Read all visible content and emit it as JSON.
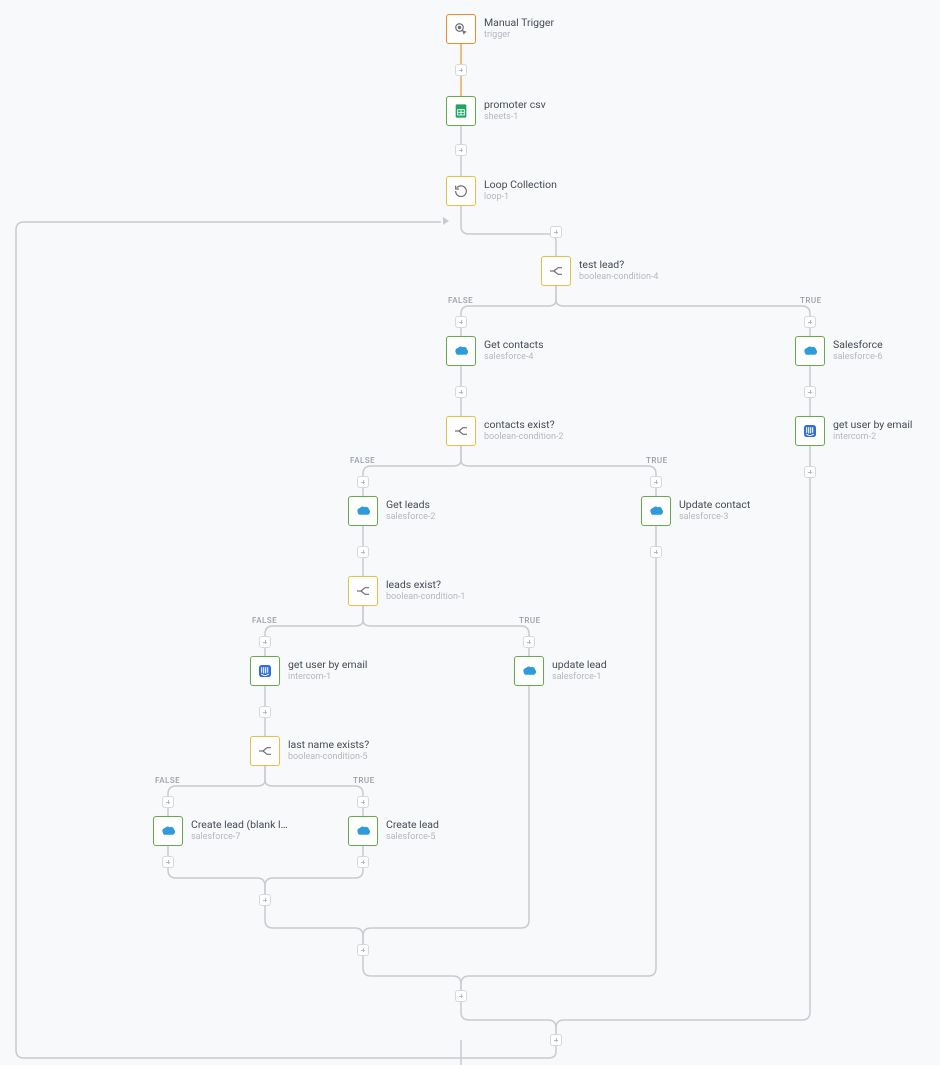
{
  "labels": {
    "true": "TRUE",
    "false": "FALSE"
  },
  "colors": {
    "orange": "#f28c28",
    "green": "#6aa84f",
    "yellow": "#e1c24a",
    "edge": "#c7cbd1",
    "edge_orange": "#f4a35a"
  },
  "nodes": {
    "manual_trigger": {
      "title": "Manual Trigger",
      "sub": "trigger",
      "icon": "click",
      "border": "orange"
    },
    "promoter_csv": {
      "title": "promoter csv",
      "sub": "sheets-1",
      "icon": "sheets",
      "border": "green"
    },
    "loop": {
      "title": "Loop Collection",
      "sub": "loop-1",
      "icon": "loop",
      "border": "yellow"
    },
    "test_lead": {
      "title": "test lead?",
      "sub": "boolean-condition-4",
      "icon": "branch",
      "border": "yellow"
    },
    "get_contacts": {
      "title": "Get contacts",
      "sub": "salesforce-4",
      "icon": "salesforce",
      "border": "green"
    },
    "sf_right": {
      "title": "Salesforce",
      "sub": "salesforce-6",
      "icon": "salesforce",
      "border": "green"
    },
    "contacts_exist": {
      "title": "contacts exist?",
      "sub": "boolean-condition-2",
      "icon": "branch",
      "border": "yellow"
    },
    "get_user_right": {
      "title": "get user by email",
      "sub": "intercom-2",
      "icon": "intercom",
      "border": "green"
    },
    "get_leads": {
      "title": "Get leads",
      "sub": "salesforce-2",
      "icon": "salesforce",
      "border": "green"
    },
    "update_contact": {
      "title": "Update contact",
      "sub": "salesforce-3",
      "icon": "salesforce",
      "border": "green"
    },
    "leads_exist": {
      "title": "leads exist?",
      "sub": "boolean-condition-1",
      "icon": "branch",
      "border": "yellow"
    },
    "get_user_left": {
      "title": "get user by email",
      "sub": "intercom-1",
      "icon": "intercom",
      "border": "green"
    },
    "update_lead": {
      "title": "update lead",
      "sub": "salesforce-1",
      "icon": "salesforce",
      "border": "green"
    },
    "last_name_exists": {
      "title": "last name exists?",
      "sub": "boolean-condition-5",
      "icon": "branch",
      "border": "yellow"
    },
    "create_lead_blank": {
      "title": "Create lead (blank l…",
      "sub": "salesforce-7",
      "icon": "salesforce",
      "border": "green"
    },
    "create_lead": {
      "title": "Create lead",
      "sub": "salesforce-5",
      "icon": "salesforce",
      "border": "green"
    }
  }
}
